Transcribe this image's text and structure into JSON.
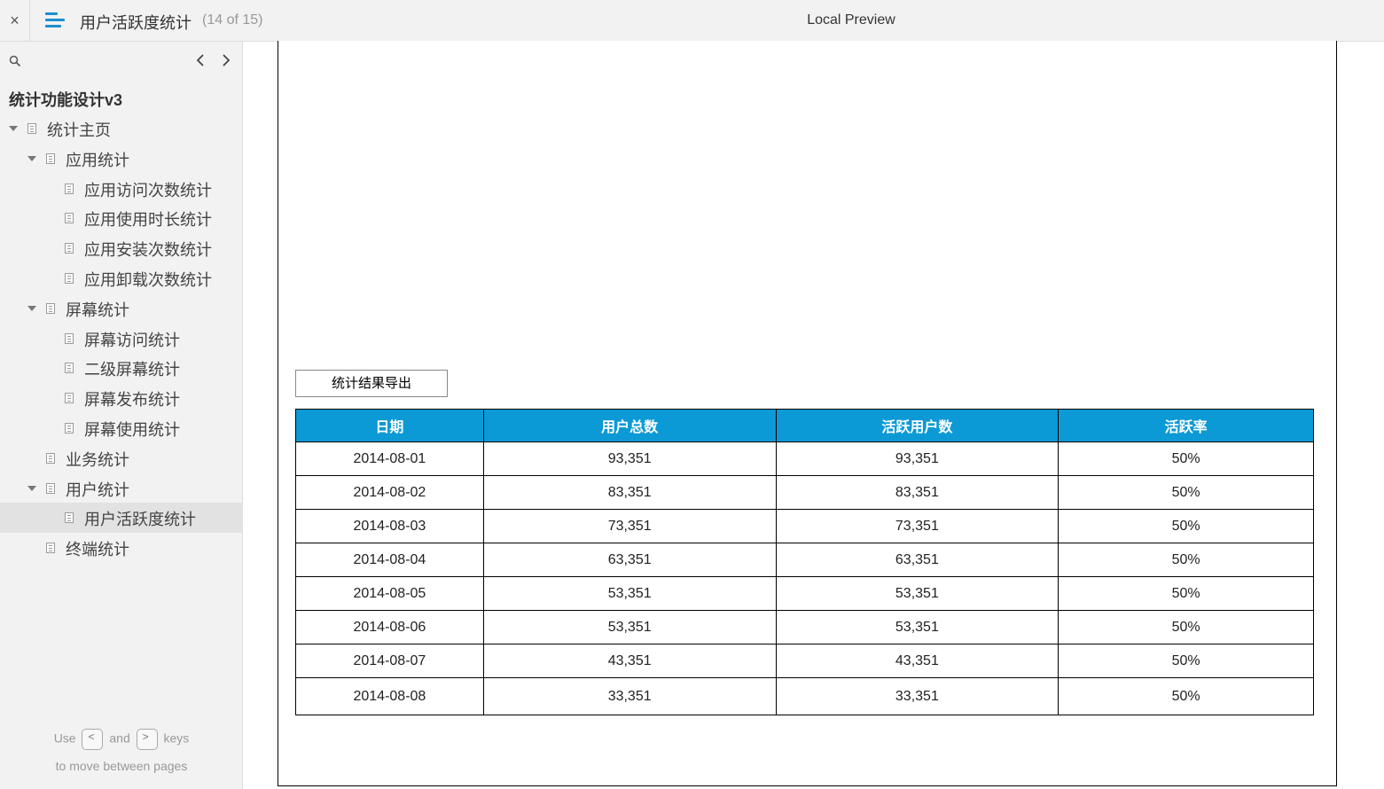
{
  "header": {
    "close_icon": "×",
    "title": "用户活跃度统计",
    "page_count": "(14 of 15)",
    "preview_label": "Local Preview"
  },
  "sidebar": {
    "project_title": "统计功能设计v3",
    "items": [
      {
        "label": "统计主页",
        "level": 0,
        "expanded": true
      },
      {
        "label": "应用统计",
        "level": 1,
        "expanded": true
      },
      {
        "label": "应用访问次数统计",
        "level": 2
      },
      {
        "label": "应用使用时长统计",
        "level": 2
      },
      {
        "label": "应用安装次数统计",
        "level": 2
      },
      {
        "label": "应用卸载次数统计",
        "level": 2
      },
      {
        "label": "屏幕统计",
        "level": 1,
        "expanded": true
      },
      {
        "label": "屏幕访问统计",
        "level": 2
      },
      {
        "label": "二级屏幕统计",
        "level": 2
      },
      {
        "label": "屏幕发布统计",
        "level": 2
      },
      {
        "label": "屏幕使用统计",
        "level": 2
      },
      {
        "label": "业务统计",
        "level": 1
      },
      {
        "label": "用户统计",
        "level": 1,
        "expanded": true
      },
      {
        "label": "用户活跃度统计",
        "level": 2,
        "selected": true
      },
      {
        "label": "终端统计",
        "level": 1
      }
    ],
    "hint": {
      "use": "Use",
      "key_prev": "<",
      "and": "and",
      "key_next": ">",
      "keys": "keys",
      "line2": "to move between pages"
    }
  },
  "main": {
    "export_button": "统计结果导出",
    "table": {
      "header_color": "#0c9ad6",
      "columns": [
        "日期",
        "用户总数",
        "活跃用户数",
        "活跃率"
      ],
      "rows": [
        [
          "2014-08-01",
          "93,351",
          "93,351",
          "50%"
        ],
        [
          "2014-08-02",
          "83,351",
          "83,351",
          "50%"
        ],
        [
          "2014-08-03",
          "73,351",
          "73,351",
          "50%"
        ],
        [
          "2014-08-04",
          "63,351",
          "63,351",
          "50%"
        ],
        [
          "2014-08-05",
          "53,351",
          "53,351",
          "50%"
        ],
        [
          "2014-08-06",
          "53,351",
          "53,351",
          "50%"
        ],
        [
          "2014-08-07",
          "43,351",
          "43,351",
          "50%"
        ],
        [
          "2014-08-08",
          "33,351",
          "33,351",
          "50%"
        ]
      ]
    }
  }
}
